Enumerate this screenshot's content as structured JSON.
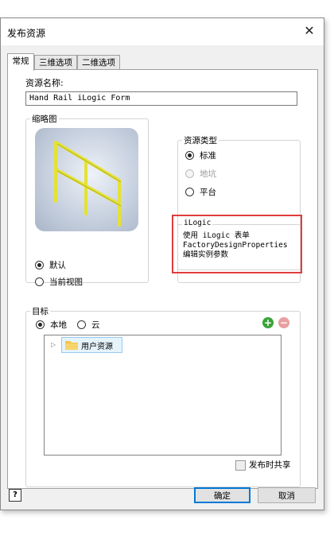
{
  "dialog": {
    "title": "发布资源",
    "close_glyph": "✕"
  },
  "tabs": [
    {
      "label": "常规",
      "active": true
    },
    {
      "label": "三维选项",
      "active": false
    },
    {
      "label": "二维选项",
      "active": false
    }
  ],
  "resource_name": {
    "label": "资源名称:",
    "value": "Hand Rail iLogic Form"
  },
  "thumbnail": {
    "legend": "缩略图",
    "options": [
      {
        "label": "默认",
        "checked": true
      },
      {
        "label": "当前视图",
        "checked": false
      }
    ]
  },
  "resource_type": {
    "legend": "资源类型",
    "options": [
      {
        "label": "标准",
        "checked": true,
        "enabled": true
      },
      {
        "label": "地坑",
        "checked": false,
        "enabled": false
      },
      {
        "label": "平台",
        "checked": false,
        "enabled": true
      }
    ]
  },
  "ilogic": {
    "legend": "iLogic",
    "lines": [
      "使用 iLogic 表单",
      "FactoryDesignProperties",
      "编辑实例参数"
    ],
    "highlight_color": "#e03c3c"
  },
  "target": {
    "legend": "目标",
    "options": [
      {
        "label": "本地",
        "checked": true
      },
      {
        "label": "云",
        "checked": false
      }
    ],
    "tree_item": "用户资源",
    "add_icon": "add-icon",
    "remove_icon": "remove-icon",
    "share_label": "发布时共享",
    "share_checked": false
  },
  "footer": {
    "help_glyph": "?",
    "ok_label": "确定",
    "cancel_label": "取消"
  },
  "colors": {
    "accent_green": "#3aa33a",
    "disabled_red": "#e8a0a0",
    "rail_yellow": "#e5e233",
    "folder_yellow": "#f4c542"
  }
}
